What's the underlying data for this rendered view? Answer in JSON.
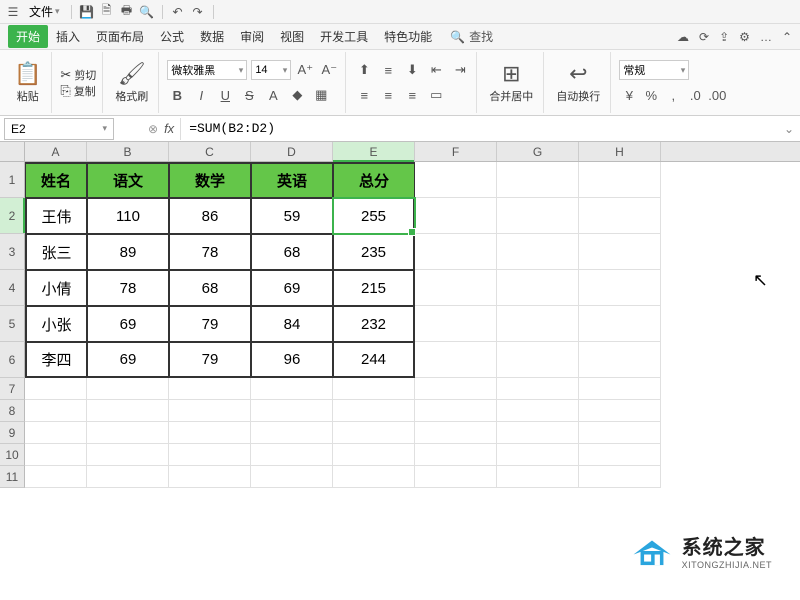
{
  "menubar": {
    "home_icon": "⌂",
    "file_menu": "文件",
    "search_label": "查找"
  },
  "tabs": {
    "start": "开始",
    "insert": "插入",
    "page_layout": "页面布局",
    "formulas": "公式",
    "data": "数据",
    "review": "审阅",
    "view": "视图",
    "developer": "开发工具",
    "features": "特色功能"
  },
  "ribbon": {
    "paste": "粘贴",
    "cut": "剪切",
    "copy": "复制",
    "format_painter": "格式刷",
    "font_name": "微软雅黑",
    "font_size": "14",
    "merge_center": "合并居中",
    "wrap_text": "自动换行",
    "number_format": "常规"
  },
  "formula_bar": {
    "cell_ref": "E2",
    "fx": "fx",
    "formula": "=SUM(B2:D2)"
  },
  "columns": [
    "A",
    "B",
    "C",
    "D",
    "E",
    "F",
    "G",
    "H"
  ],
  "row_numbers": [
    "1",
    "2",
    "3",
    "4",
    "5",
    "6",
    "7",
    "8",
    "9",
    "10",
    "11"
  ],
  "headers": {
    "name": "姓名",
    "chinese": "语文",
    "math": "数学",
    "english": "英语",
    "total": "总分"
  },
  "data_rows": [
    {
      "name": "王伟",
      "chinese": "110",
      "math": "86",
      "english": "59",
      "total": "255"
    },
    {
      "name": "张三",
      "chinese": "89",
      "math": "78",
      "english": "68",
      "total": "235"
    },
    {
      "name": "小倩",
      "chinese": "78",
      "math": "68",
      "english": "69",
      "total": "215"
    },
    {
      "name": "小张",
      "chinese": "69",
      "math": "79",
      "english": "84",
      "total": "232"
    },
    {
      "name": "李四",
      "chinese": "69",
      "math": "79",
      "english": "96",
      "total": "244"
    }
  ],
  "watermark": {
    "cn": "系统之家",
    "en": "XITONGZHIJIA.NET"
  }
}
